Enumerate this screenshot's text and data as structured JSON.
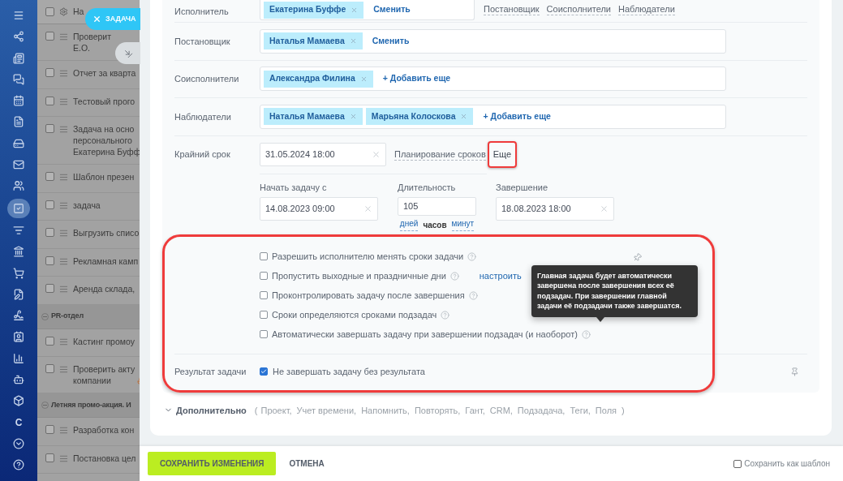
{
  "nav": {
    "items": [
      {
        "kind": "menu",
        "selected": false
      },
      {
        "kind": "network",
        "selected": false
      },
      {
        "kind": "news",
        "selected": false
      },
      {
        "kind": "chat",
        "selected": false
      },
      {
        "kind": "calendar",
        "selected": false
      },
      {
        "kind": "document",
        "selected": false
      },
      {
        "kind": "drive",
        "selected": false
      },
      {
        "kind": "mail",
        "selected": false
      },
      {
        "kind": "users",
        "selected": false
      },
      {
        "kind": "tasks",
        "selected": true
      },
      {
        "kind": "filter",
        "selected": false
      },
      {
        "kind": "bank",
        "selected": false
      },
      {
        "kind": "cart",
        "selected": false
      },
      {
        "kind": "sign-doc",
        "selected": false
      },
      {
        "kind": "signature",
        "selected": false
      },
      {
        "kind": "contact",
        "selected": false
      },
      {
        "kind": "chart",
        "selected": false
      },
      {
        "kind": "robot",
        "selected": false
      },
      {
        "kind": "box",
        "selected": false
      },
      {
        "kind": "letter",
        "text": "С",
        "selected": false
      },
      {
        "kind": "more",
        "selected": false
      },
      {
        "kind": "help",
        "selected": false
      }
    ]
  },
  "task_list": {
    "header": "На",
    "header_checked": false,
    "rows": [
      {
        "kind": "task",
        "title": "Проверит\nЕ.О.",
        "checked": false
      },
      {
        "kind": "task",
        "title": "Отчет за кварта",
        "checked": false
      },
      {
        "kind": "task",
        "title": "Тестовый прого",
        "checked": false
      },
      {
        "kind": "task",
        "title": "Задача на осно\nперсонального\nЕкатерина Буфф",
        "checked": false
      },
      {
        "kind": "task",
        "title": "Шаблон презен",
        "checked": false
      },
      {
        "kind": "task",
        "title": "задача",
        "checked": false
      },
      {
        "kind": "task",
        "title": "Выгрузить списо",
        "checked": false
      },
      {
        "kind": "task",
        "title": "Рекламная камп",
        "checked": false
      },
      {
        "kind": "task",
        "title": "Аренда склада,",
        "checked": false
      },
      {
        "kind": "group",
        "title": "PR-отдел"
      },
      {
        "kind": "task",
        "title": "Кастинг промоу",
        "checked": false
      },
      {
        "kind": "task",
        "title": "Проверить акту\nкомпании",
        "checked": false,
        "hot": true
      },
      {
        "kind": "group",
        "title": "Летняя промо-акция. И"
      },
      {
        "kind": "task",
        "title": "Разработка кон",
        "checked": false
      },
      {
        "kind": "task",
        "title": "Постановка цел",
        "checked": false
      }
    ]
  },
  "close_button": "ЗАДАЧА",
  "fields": [
    {
      "label": "Исполнитель",
      "tags": [
        "Екатерина Буффе"
      ],
      "action": "Сменить",
      "extra_links": [
        "Постановщик",
        "Соисполнители",
        "Наблюдатели"
      ]
    },
    {
      "label": "Постановщик",
      "tags": [
        "Наталья Мамаева"
      ],
      "action": "Сменить"
    },
    {
      "label": "Соисполнители",
      "tags": [
        "Александра Филина"
      ],
      "action": "+ Добавить еще"
    },
    {
      "label": "Наблюдатели",
      "tags": [
        "Наталья Мамаева",
        "Марьяна Колоскова"
      ],
      "action": "+ Добавить еще"
    }
  ],
  "deadline": {
    "label": "Крайний срок",
    "value": "31.05.2024 18:00",
    "planning_link": "Планирование сроков",
    "more_link": "Еще"
  },
  "planning": {
    "start": {
      "label": "Начать задачу с",
      "value": "14.08.2023 09:00"
    },
    "duration": {
      "label": "Длительность",
      "value": "105",
      "units": [
        {
          "text": "дней",
          "selected": false
        },
        {
          "text": "часов",
          "selected": true
        },
        {
          "text": "минут",
          "selected": false
        }
      ]
    },
    "end": {
      "label": "Завершение",
      "value": "18.08.2023 18:00"
    }
  },
  "options": [
    {
      "text": "Разрешить исполнителю менять сроки задачи",
      "checked": false
    },
    {
      "text": "Пропустить выходные и праздничные дни",
      "checked": false,
      "link": "настроить"
    },
    {
      "text": "Проконтролировать задачу после завершения",
      "checked": false
    },
    {
      "text": "Сроки определяются сроками подзадач",
      "checked": false
    },
    {
      "text": "Автоматически завершать задачу при завершении подзадач (и наоборот)",
      "checked": false
    }
  ],
  "tooltip": "Главная задача будет автоматически завершена после завершения всех её подзадач. При завершении главной задачи её подзадачи также завершатся.",
  "result": {
    "label": "Результат задачи",
    "text": "Не завершать задачу без результата",
    "checked": true
  },
  "additional": {
    "title": "Дополнительно",
    "open": "(",
    "items": [
      "Проект,",
      "Учет времени,",
      "Напомнить,",
      "Повторять,",
      "Гант,",
      "CRM,",
      "Подзадача,",
      "Теги,",
      "Поля"
    ],
    "close": ")"
  },
  "footer": {
    "save": "СОХРАНИТЬ ИЗМЕНЕНИЯ",
    "cancel": "ОТМЕНА",
    "template": {
      "text": "Сохранить как шаблон",
      "checked": false
    }
  }
}
